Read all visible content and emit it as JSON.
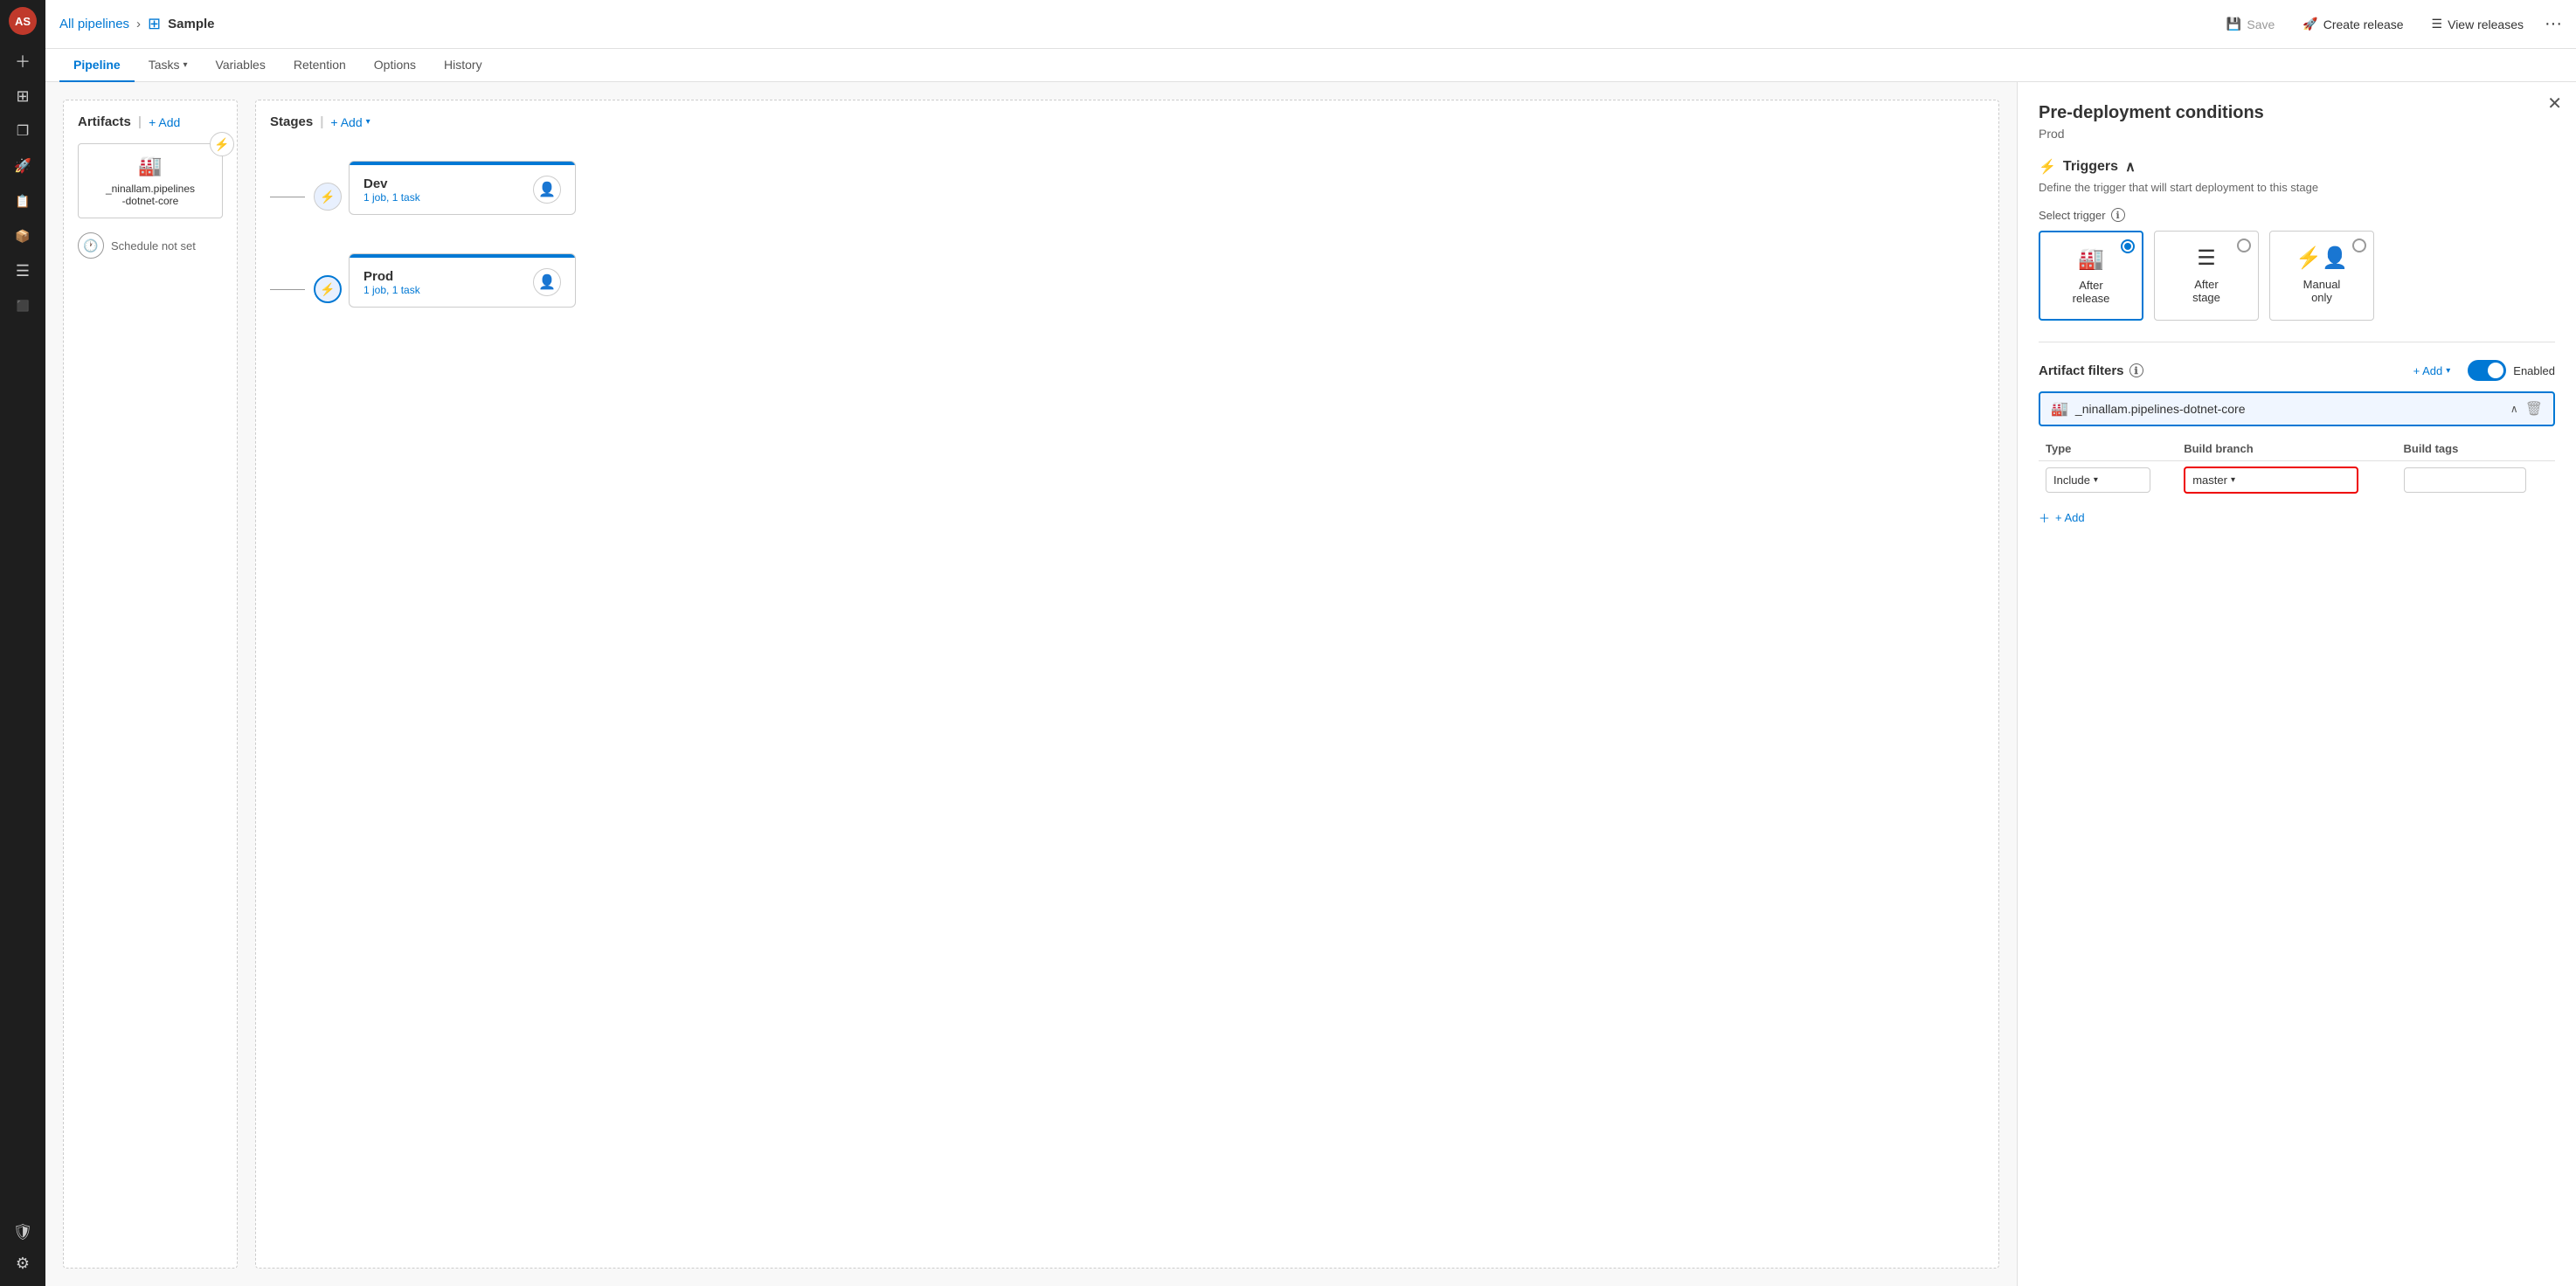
{
  "sidebar": {
    "avatar": "AS",
    "icons": [
      {
        "name": "plus-icon",
        "glyph": "＋",
        "active": false
      },
      {
        "name": "boards-icon",
        "glyph": "⊞",
        "active": false
      },
      {
        "name": "repos-icon",
        "glyph": "❐",
        "active": false
      },
      {
        "name": "pipelines-icon",
        "glyph": "🚀",
        "active": true
      },
      {
        "name": "testplans-icon",
        "glyph": "📋",
        "active": false
      },
      {
        "name": "artifacts-icon",
        "glyph": "📦",
        "active": false
      },
      {
        "name": "overview-icon",
        "glyph": "☰",
        "active": false
      },
      {
        "name": "deploy-icon",
        "glyph": "⬛",
        "active": false
      }
    ],
    "bottom_icons": [
      {
        "name": "security-icon",
        "glyph": "🛡",
        "active": false
      },
      {
        "name": "settings-icon",
        "glyph": "⚙",
        "active": false
      }
    ]
  },
  "topbar": {
    "breadcrumb_link": "All pipelines",
    "separator": "›",
    "pipeline_icon": "⊞",
    "title": "Sample",
    "save_label": "Save",
    "create_release_label": "Create release",
    "view_releases_label": "View releases",
    "more_icon": "···"
  },
  "navtabs": {
    "tabs": [
      {
        "id": "pipeline",
        "label": "Pipeline",
        "active": true,
        "has_arrow": false
      },
      {
        "id": "tasks",
        "label": "Tasks",
        "active": false,
        "has_arrow": true
      },
      {
        "id": "variables",
        "label": "Variables",
        "active": false,
        "has_arrow": false
      },
      {
        "id": "retention",
        "label": "Retention",
        "active": false,
        "has_arrow": false
      },
      {
        "id": "options",
        "label": "Options",
        "active": false,
        "has_arrow": false
      },
      {
        "id": "history",
        "label": "History",
        "active": false,
        "has_arrow": false
      }
    ]
  },
  "canvas": {
    "artifacts_header": "Artifacts",
    "artifacts_add": "+ Add",
    "artifact_name": "_ninallam.pipelines\n-dotnet-core",
    "schedule_label": "Schedule not set",
    "stages_header": "Stages",
    "stages_add": "+ Add",
    "stages": [
      {
        "id": "dev",
        "name": "Dev",
        "tasks": "1 job, 1 task"
      },
      {
        "id": "prod",
        "name": "Prod",
        "tasks": "1 job, 1 task"
      }
    ]
  },
  "right_panel": {
    "title": "Pre-deployment conditions",
    "subtitle": "Prod",
    "triggers_label": "Triggers",
    "triggers_desc": "Define the trigger that will start deployment to this stage",
    "select_trigger_label": "Select trigger",
    "trigger_cards": [
      {
        "id": "after-release",
        "label": "After\nrelease",
        "selected": true,
        "icon": "🏭"
      },
      {
        "id": "after-stage",
        "label": "After\nstage",
        "selected": false,
        "icon": "☰"
      },
      {
        "id": "manual-only",
        "label": "Manual\nonly",
        "selected": false,
        "icon": "⚡👤"
      }
    ],
    "artifact_filters_title": "Artifact filters",
    "add_filter_label": "+ Add",
    "enabled_label": "Enabled",
    "artifact_dropdown_name": "_ninallam.pipelines-dotnet-core",
    "filter_table": {
      "headers": [
        "Type",
        "Build branch",
        "Build tags"
      ],
      "rows": [
        {
          "type": "Include",
          "build_branch": "master",
          "build_tags": ""
        }
      ]
    },
    "add_row_label": "+ Add"
  }
}
